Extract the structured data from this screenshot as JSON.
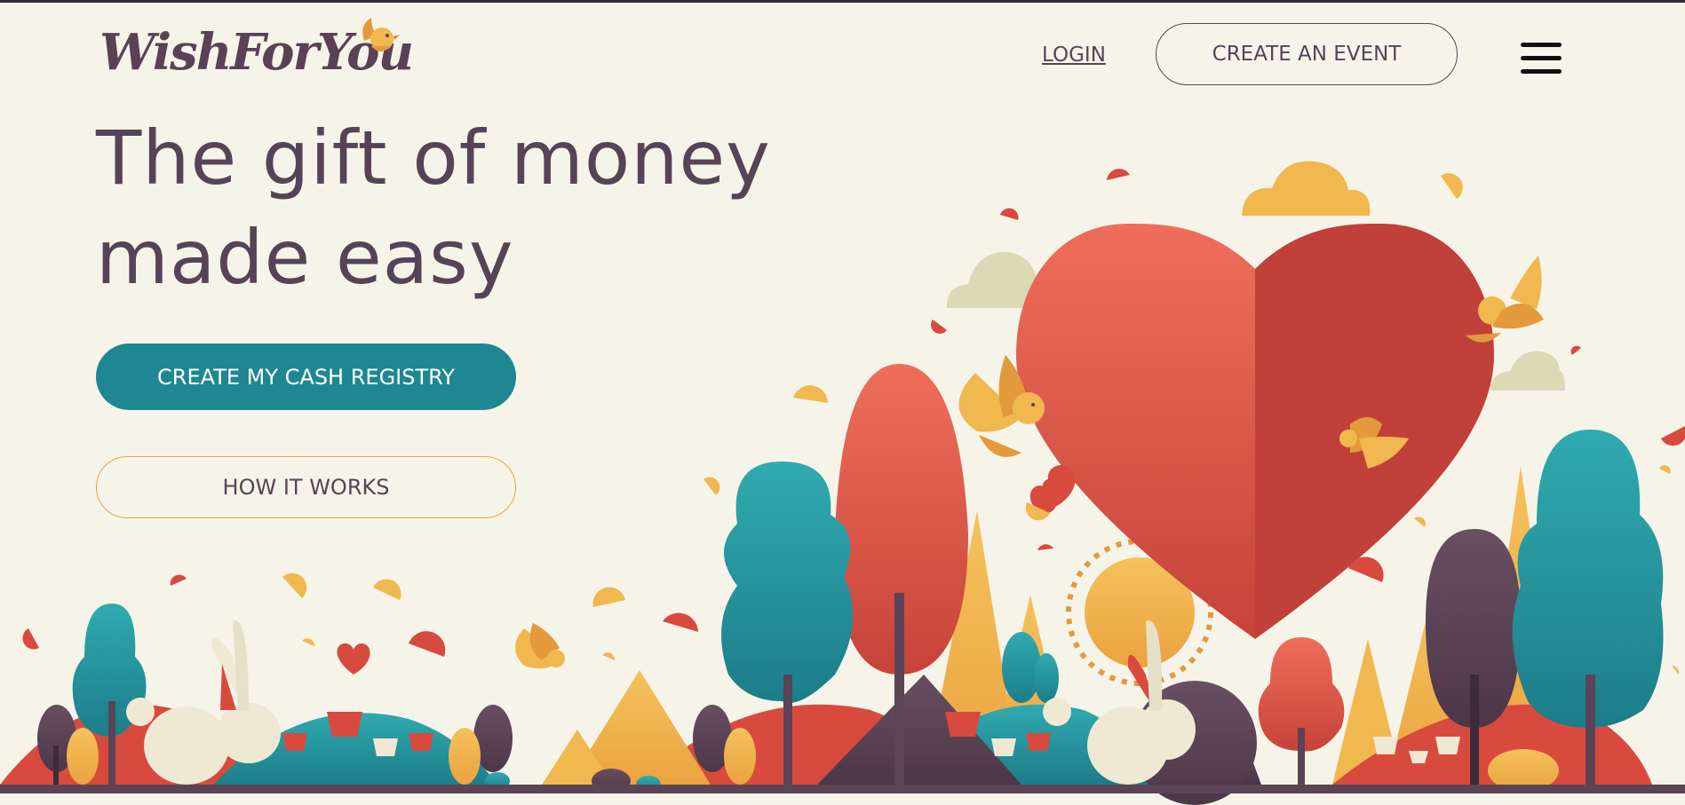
{
  "brand": {
    "name": "WishForYou"
  },
  "nav": {
    "login_label": "LOGIN",
    "create_event_label": "CREATE AN EVENT"
  },
  "hero": {
    "title_lines": [
      "The gift of money",
      "made easy"
    ],
    "primary_cta": "CREATE MY CASH REGISTRY",
    "secondary_cta": "HOW IT WORKS"
  },
  "colors": {
    "background": "#f6f4e9",
    "text": "#574358",
    "teal": "#1e8791",
    "red": "#d94a3e",
    "yellow": "#f0b84f",
    "purple": "#5a4456",
    "cream": "#efe9d4"
  },
  "icons": [
    "bird-icon",
    "hamburger-menu-icon",
    "heart-icon"
  ]
}
